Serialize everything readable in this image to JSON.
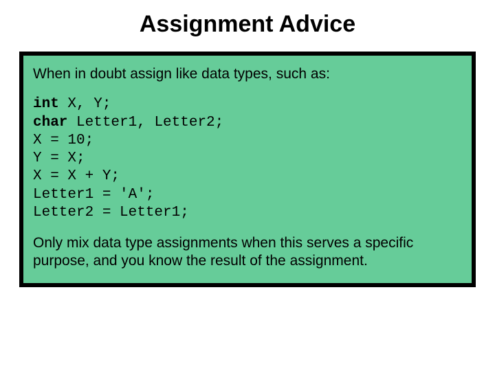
{
  "title": "Assignment Advice",
  "panel": {
    "intro": "When in doubt assign like data types, such as:",
    "code": {
      "kw_int": "int",
      "line1_rest": " X, Y;",
      "kw_char": "char",
      "line2_rest": " Letter1, Letter2;",
      "line3": "X = 10;",
      "line4": "Y = X;",
      "line5": "X = X + Y;",
      "line6": "Letter1 = 'A';",
      "line7": "Letter2 = Letter1;"
    },
    "outro": "Only mix data type assignments when this serves a specific purpose, and you know the result of the assignment."
  }
}
